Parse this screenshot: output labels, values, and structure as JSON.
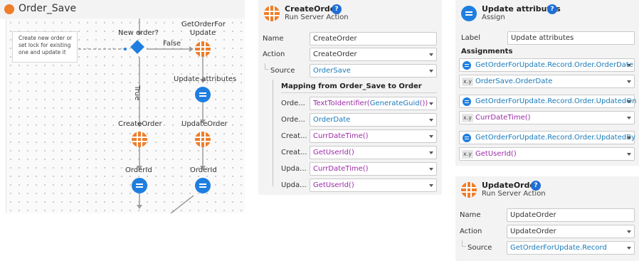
{
  "flow": {
    "title": "Order_Save",
    "comment": [
      "Create new order or",
      "set lock for existing",
      "one and update it"
    ],
    "nodes": {
      "decision": "New order?",
      "get_order_line1": "GetOrderFor",
      "get_order_line2": "Update",
      "update_attrs": "Update attributes",
      "create_order": "CreateOrder",
      "update_order": "UpdateOrder",
      "order_id_left": "OrderId",
      "order_id_right": "OrderId"
    },
    "connectors": {
      "false_label": "False",
      "true_label": "True"
    }
  },
  "create_order": {
    "title": "CreateOrder",
    "subtitle": "Run Server Action",
    "help": "?",
    "name_label": "Name",
    "name_value": "CreateOrder",
    "action_label": "Action",
    "action_value": "CreateOrder",
    "source_label": "Source",
    "source_value": "OrderSave",
    "mapping_title": "Mapping from Order_Save to Order",
    "mappings": [
      {
        "label": "Orde...",
        "value_fn": "TextToIdentifier(",
        "value_exp": "GenerateGuid",
        "value_tail": "())"
      },
      {
        "label": "Orde...",
        "value_fn": "",
        "value_exp": "OrderDate",
        "value_tail": ""
      },
      {
        "label": "Creat...",
        "value_fn": "CurrDateTime()",
        "value_exp": "",
        "value_tail": ""
      },
      {
        "label": "Creat...",
        "value_fn": "GetUserId()",
        "value_exp": "",
        "value_tail": ""
      },
      {
        "label": "Upda...",
        "value_fn": "CurrDateTime()",
        "value_exp": "",
        "value_tail": ""
      },
      {
        "label": "Upda...",
        "value_fn": "GetUserId()",
        "value_exp": "",
        "value_tail": ""
      }
    ]
  },
  "assign": {
    "title": "Update attributes",
    "subtitle": "Assign",
    "help": "?",
    "label_label": "Label",
    "label_value": "Update attributes",
    "assignments_title": "Assignments",
    "xy": "x.y",
    "assignments": [
      {
        "target": "GetOrderForUpdate.Record.Order.OrderDate",
        "value": "OrderSave.OrderDate"
      },
      {
        "target": "GetOrderForUpdate.Record.Order.UpdatedOn",
        "value": "CurrDateTime()"
      },
      {
        "target": "GetOrderForUpdate.Record.Order.UpdatedBy",
        "value": "GetUserId()"
      }
    ]
  },
  "update_order": {
    "title": "UpdateOrder",
    "subtitle": "Run Server Action",
    "help": "?",
    "name_label": "Name",
    "name_value": "UpdateOrder",
    "action_label": "Action",
    "action_value": "UpdateOrder",
    "source_label": "Source",
    "source_value": "GetOrderForUpdate.Record"
  },
  "colors": {
    "assign_blue": "#1f7ee0",
    "server_orange": "#ef7d2a",
    "expression_blue": "#1a7ab8",
    "function_purple": "#9b2aa5",
    "help_blue": "#1f6fd6"
  }
}
